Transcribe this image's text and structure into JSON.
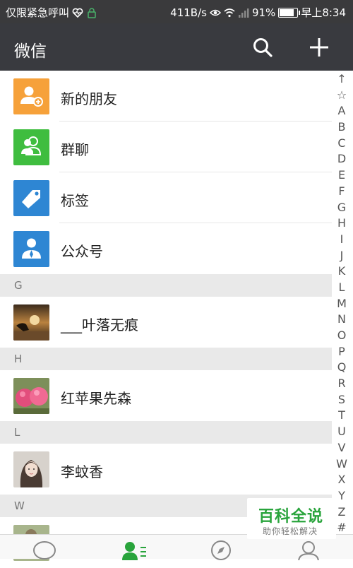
{
  "status_bar": {
    "left_text": "仅限紧急呼叫",
    "net_speed": "411B/s",
    "battery": "91%",
    "battery_level": 0.91,
    "time": "早上8:34"
  },
  "header": {
    "title": "微信"
  },
  "functions": [
    {
      "label": "新的朋友",
      "icon": "new-friends-icon",
      "color": "#f6a13a"
    },
    {
      "label": "群聊",
      "icon": "group-chat-icon",
      "color": "#3fbd3f"
    },
    {
      "label": "标签",
      "icon": "tag-icon",
      "color": "#2e86d3"
    },
    {
      "label": "公众号",
      "icon": "official-account-icon",
      "color": "#2e86d3"
    }
  ],
  "sections": [
    {
      "letter": "G",
      "contacts": [
        {
          "name": "___叶落无痕"
        }
      ]
    },
    {
      "letter": "H",
      "contacts": [
        {
          "name": "红苹果先森"
        }
      ]
    },
    {
      "letter": "L",
      "contacts": [
        {
          "name": "李蚊香"
        }
      ]
    },
    {
      "letter": "W",
      "contacts": []
    }
  ],
  "index_letters": [
    "↑",
    "☆",
    "A",
    "B",
    "C",
    "D",
    "E",
    "F",
    "G",
    "H",
    "I",
    "J",
    "K",
    "L",
    "M",
    "N",
    "O",
    "P",
    "Q",
    "R",
    "S",
    "T",
    "U",
    "V",
    "W",
    "X",
    "Y",
    "Z",
    "#"
  ],
  "watermark": {
    "title": "百科全说",
    "subtitle": "助你轻松解决"
  },
  "colors": {
    "accent_green": "#29a43c",
    "titlebar": "#393a3f",
    "section_bg": "#e9e9e9"
  }
}
